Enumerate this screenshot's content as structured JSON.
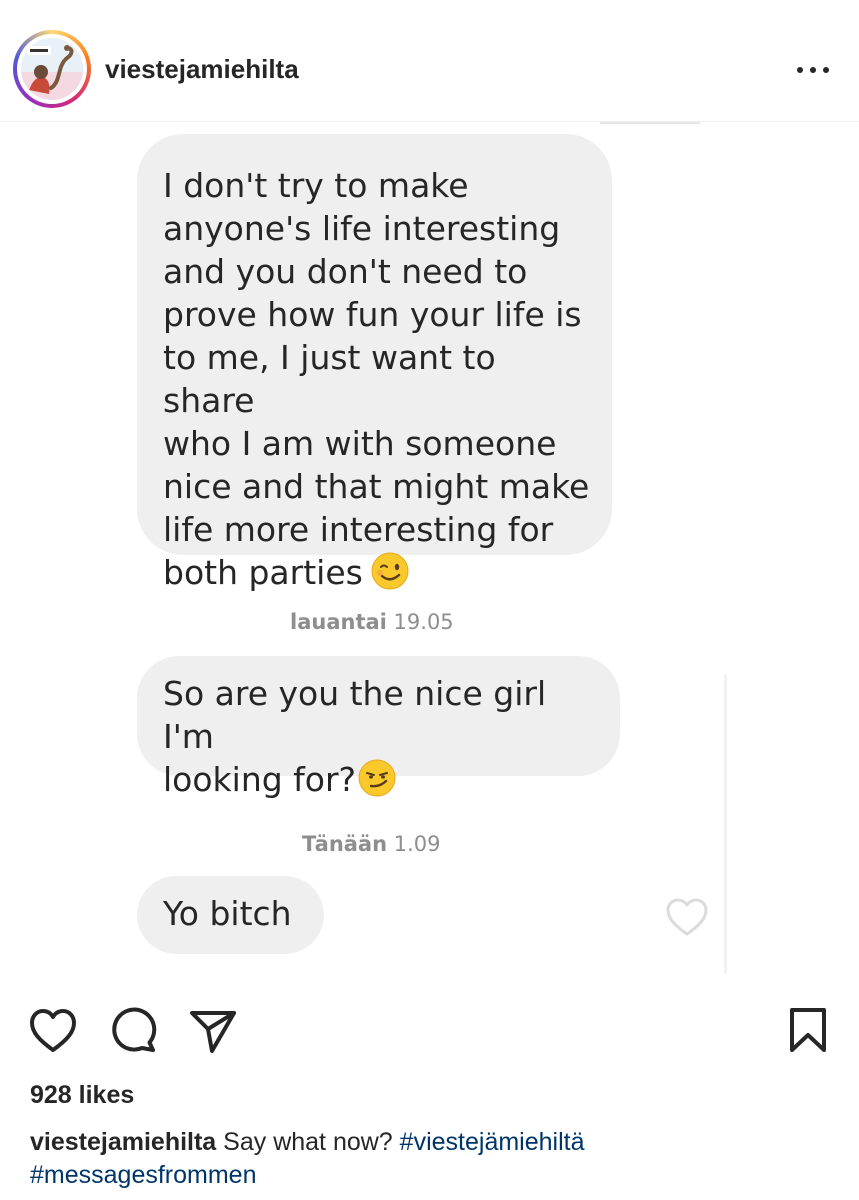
{
  "header": {
    "username": "viestejamiehilta",
    "more_label": "More options"
  },
  "photo": {
    "messages": [
      {
        "text": "I don't try to make\nanyone's life interesting\nand you don't need to\nprove how fun your life is\nto me, I just want to share\nwho I am with someone\nnice and that might make\nlife more interesting for\nboth parties",
        "emoji": "winking-face"
      },
      {
        "text": "So are you the nice girl I'm\nlooking for?",
        "emoji": "smirking-face"
      },
      {
        "text": "Yo bitch",
        "emoji": ""
      }
    ],
    "timestamps": [
      {
        "day": "lauantai",
        "time": "19.05"
      },
      {
        "day": "Tänään",
        "time": "1.09"
      }
    ]
  },
  "actions": {
    "like_icon": "heart-outline",
    "comment_icon": "speech-bubble",
    "share_icon": "paper-plane",
    "save_icon": "bookmark"
  },
  "likes": "928 likes",
  "caption": {
    "username": "viestejamiehilta",
    "text": "Say what now?",
    "hashtags": [
      "#viestejämiehiltä",
      "#messagesfrommen"
    ]
  },
  "colors": {
    "text": "#262626",
    "bubble": "#efefef",
    "timestamp": "#8e8e8e",
    "hashtag": "#003569",
    "emoji": "#f9c92b"
  }
}
